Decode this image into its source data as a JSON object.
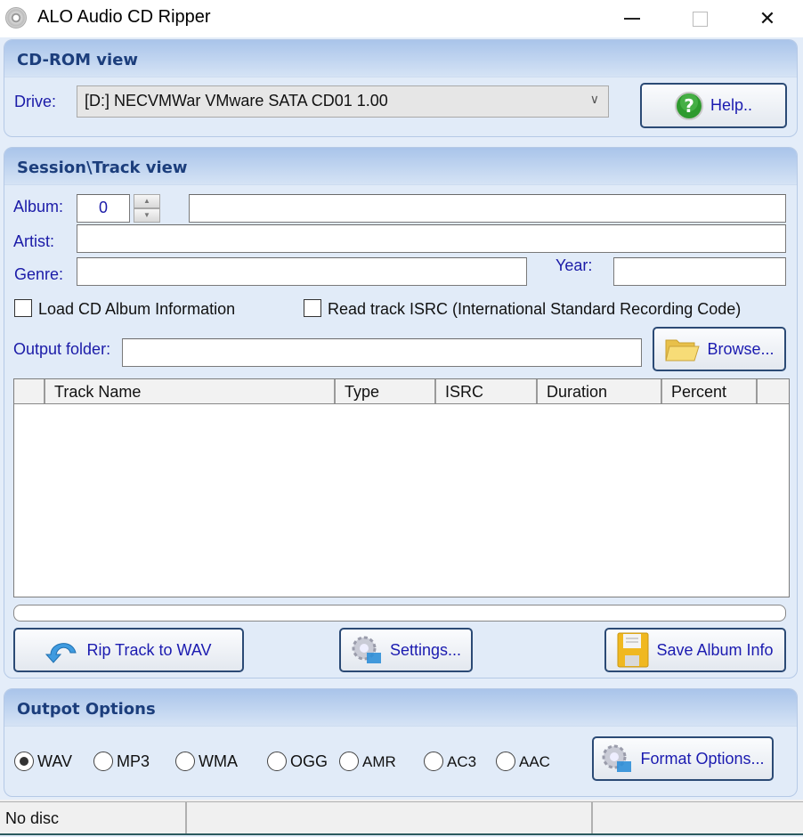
{
  "window": {
    "title": "ALO Audio CD Ripper",
    "icon": "cd-disc-icon",
    "controls": {
      "minimize": "minimize-icon",
      "maximize": "maximize-icon",
      "close": "close-icon"
    }
  },
  "cdrom": {
    "header": "CD-ROM view",
    "drive_label": "Drive:",
    "drive_value": "[D:]  NECVMWar  VMware SATA CD01  1.00",
    "help_label": "Help.."
  },
  "session": {
    "header": "Session\\Track view",
    "album_label": "Album:",
    "album_number": "0",
    "album_title": "",
    "artist_label": "Artist:",
    "artist_value": "",
    "genre_label": "Genre:",
    "genre_value": "",
    "year_label": "Year:",
    "year_value": "",
    "load_cd_info_label": "Load CD Album Information",
    "load_cd_info_checked": false,
    "read_isrc_label": "Read track ISRC (International Standard Recording Code)",
    "read_isrc_checked": false,
    "output_folder_label": "Output folder:",
    "output_folder_value": "",
    "browse_label": "Browse...",
    "columns": [
      "",
      "Track Name",
      "Type",
      "ISRC",
      "Duration",
      "Percent",
      ""
    ],
    "rows": [],
    "progress": 0,
    "rip_label": "Rip Track to WAV",
    "settings_label": "Settings...",
    "save_album_label": "Save Album Info"
  },
  "output": {
    "header": "Outpot Options",
    "formats": [
      {
        "label": "WAV",
        "selected": true
      },
      {
        "label": "MP3",
        "selected": false
      },
      {
        "label": "WMA",
        "selected": false
      },
      {
        "label": "OGG",
        "selected": false
      },
      {
        "label": "AMR",
        "selected": false
      },
      {
        "label": "AC3",
        "selected": false
      },
      {
        "label": "AAC",
        "selected": false
      }
    ],
    "format_options_label": "Format Options..."
  },
  "status": {
    "panels": [
      "No disc",
      "",
      ""
    ]
  }
}
